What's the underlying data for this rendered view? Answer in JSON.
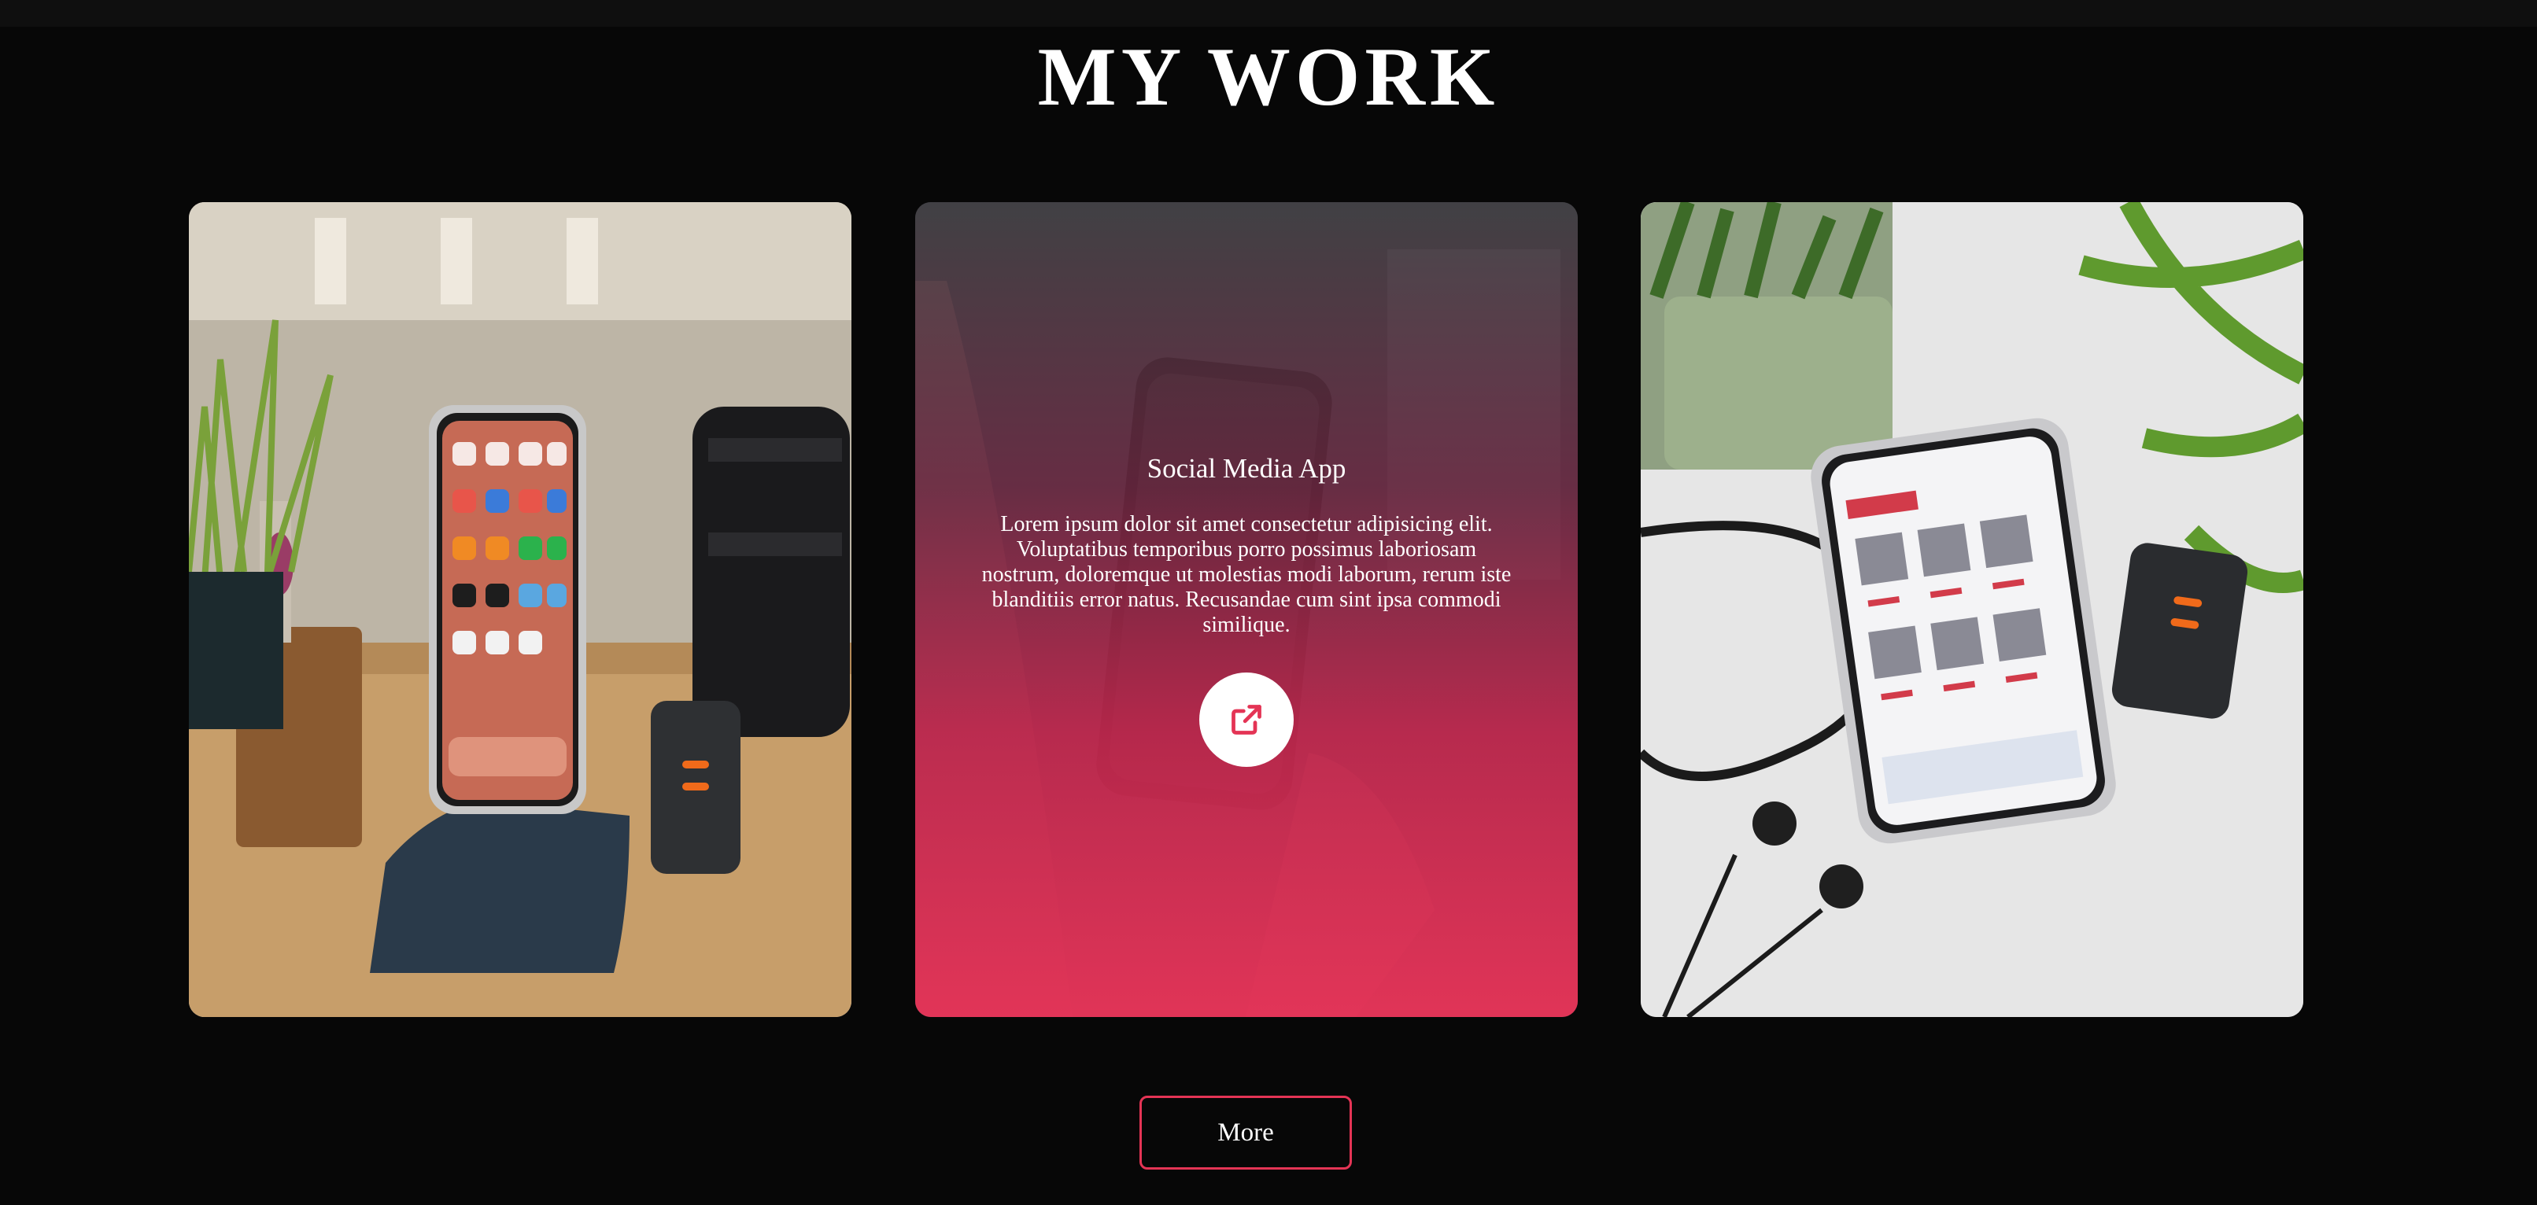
{
  "section": {
    "title": "MY WORK"
  },
  "projects": [
    {
      "image": "phone-on-stand-photo"
    },
    {
      "image": "hand-holding-phone-photo",
      "title": "Social Media App",
      "description": "Lorem ipsum dolor sit amet consectetur adipisicing elit. Voluptatibus temporibus porro possimus laboriosam nostrum, doloremque ut molestias modi laborum, rerum iste blanditiis error natus. Recusandae cum sint ipsa commodi similique.",
      "link_icon": "external-link-icon"
    },
    {
      "image": "phone-store-app-photo"
    }
  ],
  "more_button": {
    "label": "More"
  },
  "colors": {
    "accent": "#e43455",
    "background": "#070707",
    "text": "#ffffff"
  }
}
